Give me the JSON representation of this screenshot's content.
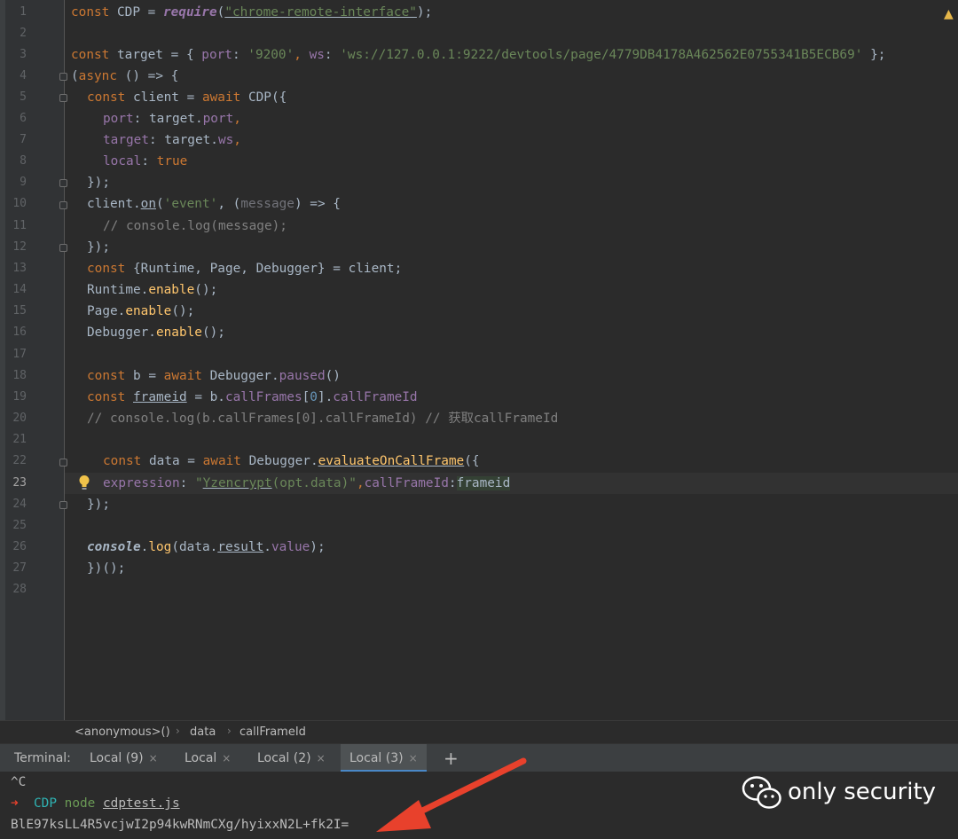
{
  "editor": {
    "line_numbers": [
      "1",
      "2",
      "3",
      "4",
      "5",
      "6",
      "7",
      "8",
      "9",
      "10",
      "11",
      "12",
      "13",
      "14",
      "15",
      "16",
      "17",
      "18",
      "19",
      "20",
      "21",
      "22",
      "23",
      "24",
      "25",
      "26",
      "27",
      "28"
    ],
    "current_line": "23",
    "code": {
      "l1": {
        "a": "const",
        "b": " CDP = ",
        "c": "require",
        "d": "(",
        "e": "\"chrome-remote-interface\"",
        "f": ");"
      },
      "l3": {
        "a": "const",
        "b": " target = { ",
        "c": "port",
        "d": ": ",
        "e": "'9200'",
        "f": ", ",
        "g": "ws",
        "h": ": ",
        "i": "'ws://127.0.0.1:9222/devtools/page/4779DB4178A462562E0755341B5ECB69'",
        "j": " };"
      },
      "l4": {
        "a": "(",
        "b": "async",
        "c": " () => {"
      },
      "l5": {
        "a": "const",
        "b": " client = ",
        "c": "await",
        "d": " CDP({"
      },
      "l6": {
        "a": "port",
        "b": ": target.",
        "c": "port",
        "d": ","
      },
      "l7": {
        "a": "target",
        "b": ": target.",
        "c": "ws",
        "d": ","
      },
      "l8": {
        "a": "local",
        "b": ": ",
        "c": "true"
      },
      "l9": {
        "a": "});"
      },
      "l10": {
        "a": "client.",
        "b": "on",
        "c": "(",
        "d": "'event'",
        "e": ", (",
        "f": "message",
        "g": ") => {"
      },
      "l11": {
        "a": "// console.log(message);"
      },
      "l12": {
        "a": "});"
      },
      "l13": {
        "a": "const",
        "b": " {Runtime, Page, Debugger} = client;"
      },
      "l14": {
        "a": "Runtime.",
        "b": "enable",
        "c": "();"
      },
      "l15": {
        "a": "Page.",
        "b": "enable",
        "c": "();"
      },
      "l16": {
        "a": "Debugger.",
        "b": "enable",
        "c": "();"
      },
      "l18": {
        "a": "const",
        "b": " b = ",
        "c": "await",
        "d": " Debugger.",
        "e": "paused",
        "f": "()"
      },
      "l19": {
        "a": "const",
        "b": " ",
        "c": "frameid",
        "d": " = b.",
        "e": "callFrames",
        "f": "[",
        "g": "0",
        "h": "].",
        "i": "callFrameId"
      },
      "l20": {
        "a": "// console.log(b.callFrames[0].callFrameId) // 获取callFrameId"
      },
      "l22": {
        "a": "const",
        "b": " data = ",
        "c": "await",
        "d": " Debugger.",
        "e": "evaluateOnCallFrame",
        "f": "({"
      },
      "l23": {
        "a": "expression",
        "b": ": ",
        "c": "\"",
        "d": "Yzencrypt",
        "e": "(opt.data)\"",
        "f": ",",
        "g": "callFrameId",
        "h": ":",
        "i": "frameid"
      },
      "l24": {
        "a": "});"
      },
      "l26": {
        "a": "console",
        "b": ".",
        "c": "log",
        "d": "(data.",
        "e": "result",
        "f": ".",
        "g": "value",
        "h": ");"
      },
      "l27": {
        "a": "})();"
      }
    }
  },
  "breadcrumb": [
    "<anonymous>()",
    "data",
    "callFrameId"
  ],
  "terminal": {
    "label": "Terminal:",
    "tabs": [
      {
        "label": "Local (9)",
        "close": "×"
      },
      {
        "label": "Local",
        "close": "×"
      },
      {
        "label": "Local (2)",
        "close": "×"
      },
      {
        "label": "Local (3)",
        "close": "×"
      }
    ],
    "add": "+",
    "lines": {
      "ctrl_c": "^C",
      "prompt_arrow": "➜",
      "prompt_dir": "CDP",
      "prompt_cmd": "node",
      "prompt_file": "cdptest.js",
      "output": "BlE97ksLL4R5vcjwI2p94kwRNmCXg/hyixxN2L+fk2I="
    }
  },
  "watermark": {
    "text": "only security"
  },
  "colors": {
    "arrow": "#e8412c",
    "accent": "#4a88c7"
  }
}
